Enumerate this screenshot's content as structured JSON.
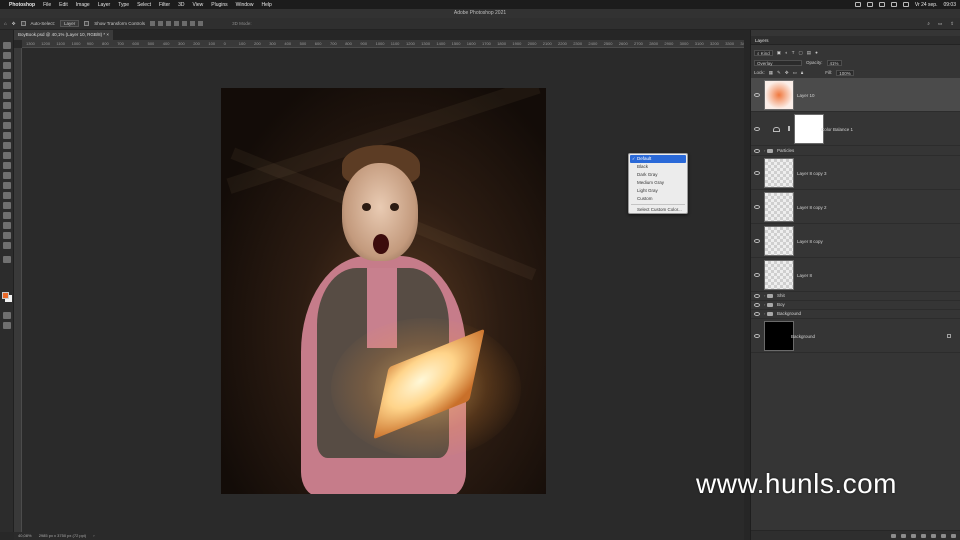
{
  "menubar": {
    "app": "Photoshop",
    "items": [
      "File",
      "Edit",
      "Image",
      "Layer",
      "Type",
      "Select",
      "Filter",
      "3D",
      "View",
      "Plugins",
      "Window",
      "Help"
    ],
    "date": "Vr 24 sep.",
    "time": "09:03"
  },
  "window_title": "Adobe Photoshop 2021",
  "options_bar": {
    "auto_select_label": "Auto-Select:",
    "auto_select_value": "Layer",
    "transform_controls_label": "Show Transform Controls",
    "mode_3d_label": "3D Mode:"
  },
  "document_tab": "BoyBook.psd @ 40,1% (Layer 10, RGB/8) *",
  "ruler_ticks": [
    "1300",
    "1200",
    "1100",
    "1000",
    "900",
    "800",
    "700",
    "600",
    "500",
    "400",
    "300",
    "200",
    "100",
    "0",
    "100",
    "200",
    "300",
    "400",
    "500",
    "600",
    "700",
    "800",
    "900",
    "1000",
    "1100",
    "1200",
    "1300",
    "1400",
    "1500",
    "1600",
    "1700",
    "1800",
    "1900",
    "2000",
    "2100",
    "2200",
    "2300",
    "2400",
    "2500",
    "2600",
    "2700",
    "2800",
    "2900",
    "3000",
    "3100",
    "3200",
    "3300",
    "3400"
  ],
  "color_menu": {
    "items": [
      "Default",
      "Black",
      "Dark Gray",
      "Medium Gray",
      "Light Gray",
      "Custom"
    ],
    "selected": "Default",
    "footer": "Select Custom Color..."
  },
  "status": {
    "zoom": "40,08%",
    "doc_size": "2985 px x 3750 px (72 ppi)"
  },
  "layers_panel": {
    "title": "Layers",
    "filter_label": "Kind",
    "blend_mode": "Overlay",
    "opacity_label": "Opacity:",
    "opacity_value": "41%",
    "lock_label": "Lock:",
    "fill_label": "Fill:",
    "fill_value": "100%",
    "layers": [
      {
        "name": "Layer 10",
        "kind": "pixel",
        "thumb": "glow",
        "active": true
      },
      {
        "name": "Color Balance 1",
        "kind": "adjustment",
        "thumb": "white"
      },
      {
        "name": "Particles",
        "kind": "group"
      },
      {
        "name": "Layer 8 copy 3",
        "kind": "pixel",
        "thumb": "transparent"
      },
      {
        "name": "Layer 8 copy 2",
        "kind": "pixel",
        "thumb": "transparent"
      },
      {
        "name": "Layer 8 copy",
        "kind": "pixel",
        "thumb": "transparent"
      },
      {
        "name": "Layer 8",
        "kind": "pixel",
        "thumb": "transparent"
      },
      {
        "name": "Shit",
        "kind": "group"
      },
      {
        "name": "Boy",
        "kind": "group"
      },
      {
        "name": "Background",
        "kind": "group"
      },
      {
        "name": "Background",
        "kind": "pixel",
        "thumb": "black",
        "locked": true
      }
    ]
  },
  "watermark": "www.hunls.com",
  "colors": {
    "accent": "#2a69d8",
    "foreground_swatch": "#e8692a",
    "background_swatch": "#f2f2f2"
  }
}
